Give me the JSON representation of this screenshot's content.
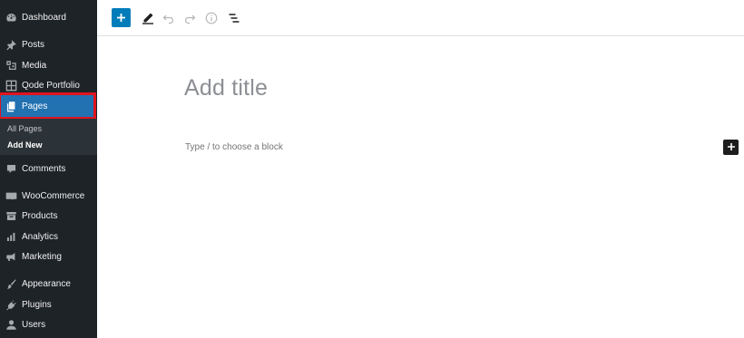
{
  "sidebar": {
    "items": [
      {
        "name": "dashboard",
        "label": "Dashboard",
        "icon": "dashboard-icon"
      },
      {
        "name": "posts",
        "label": "Posts",
        "icon": "pin-icon"
      },
      {
        "name": "media",
        "label": "Media",
        "icon": "media-icon"
      },
      {
        "name": "qode-portfolio",
        "label": "Qode Portfolio",
        "icon": "grid-icon"
      },
      {
        "name": "pages",
        "label": "Pages",
        "icon": "pages-icon",
        "active": true
      },
      {
        "name": "comments",
        "label": "Comments",
        "icon": "comment-icon"
      },
      {
        "name": "woocommerce",
        "label": "WooCommerce",
        "icon": "woocommerce-icon"
      },
      {
        "name": "products",
        "label": "Products",
        "icon": "archive-icon"
      },
      {
        "name": "analytics",
        "label": "Analytics",
        "icon": "bar-chart-icon"
      },
      {
        "name": "marketing",
        "label": "Marketing",
        "icon": "megaphone-icon"
      },
      {
        "name": "appearance",
        "label": "Appearance",
        "icon": "brush-icon"
      },
      {
        "name": "plugins",
        "label": "Plugins",
        "icon": "plug-icon"
      },
      {
        "name": "users",
        "label": "Users",
        "icon": "user-icon"
      }
    ],
    "submenu": {
      "all_pages": "All Pages",
      "add_new": "Add New"
    }
  },
  "toolbar": {
    "add_block": "plus-icon",
    "tools": "pencil-icon",
    "undo": "undo-icon",
    "redo": "redo-icon",
    "details": "info-icon",
    "outline": "list-view-icon"
  },
  "editor": {
    "title_placeholder": "Add title",
    "block_placeholder": "Type / to choose a block"
  },
  "colors": {
    "sidebar_bg": "#1e2327",
    "accent": "#2271b1",
    "highlight_outline": "#e0141e",
    "toolbar_add_button": "#007cba"
  }
}
